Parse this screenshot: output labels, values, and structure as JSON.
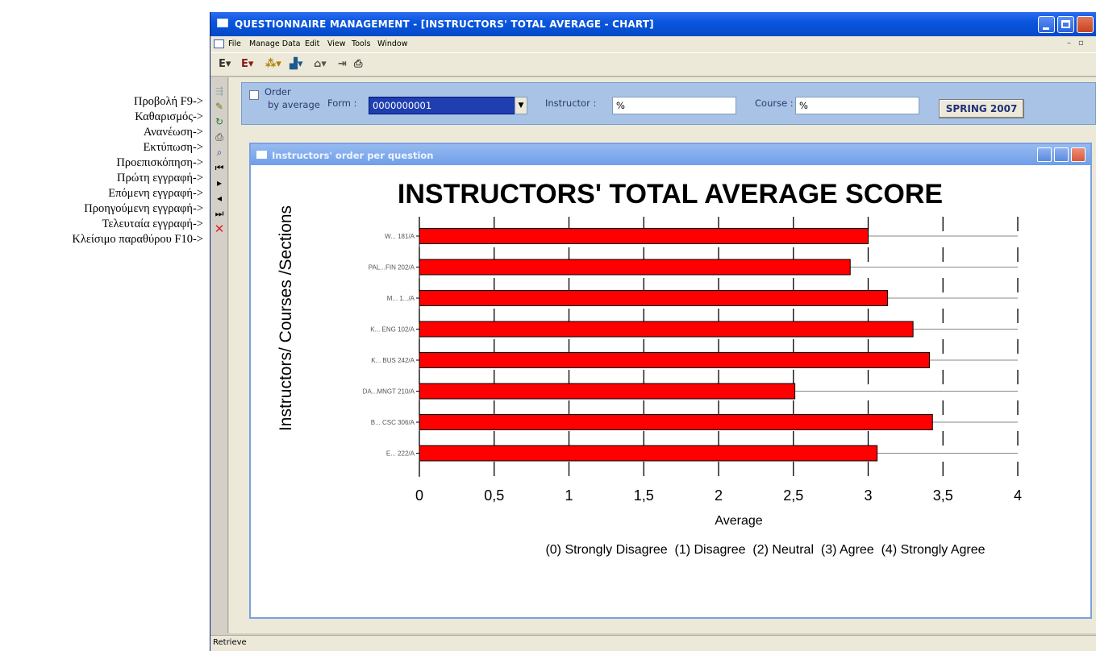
{
  "annotations": [
    "Προβολή F9->",
    "Καθαρισμός->",
    "Ανανέωση->",
    "Εκτύπωση->",
    "Προεπισκόπηση->",
    "Πρώτη εγγραφή->",
    "Επόμενη εγγραφή->",
    "Προηγούμενη εγγραφή->",
    "Τελευταία εγγραφή->",
    "Κλείσιμο παραθύρου F10->"
  ],
  "window": {
    "title": "QUESTIONNAIRE MANAGEMENT - [INSTRUCTORS' TOTAL AVERAGE - CHART]"
  },
  "menu": [
    "File",
    "Manage Data",
    "Edit",
    "View",
    "Tools",
    "Window"
  ],
  "filter": {
    "order_label_line1": "Order",
    "order_label_line2": "by average",
    "form_label": "Form :",
    "form_value": "0000000001",
    "instructor_label": "Instructor :",
    "instructor_value": "%",
    "course_label": "Course :",
    "course_value": "%",
    "semester_button": "SPRING 2007"
  },
  "chart_window": {
    "title": "Instructors' order per question"
  },
  "status": {
    "text": "Retrieve"
  },
  "colors": {
    "bar": "#ff0000",
    "titlebar": "#0a56de",
    "filterbar": "#a9c3e6"
  },
  "chart_data": {
    "type": "bar",
    "orientation": "horizontal",
    "title": "INSTRUCTORS' TOTAL AVERAGE SCORE",
    "xlabel": "Average",
    "ylabel": "Instructors/ Courses /Sections",
    "xlim": [
      0,
      4
    ],
    "xticks": [
      "0",
      "0,5",
      "1",
      "1,5",
      "2",
      "2,5",
      "3",
      "3,5",
      "4"
    ],
    "grid": true,
    "categories": [
      "W... 181/A",
      "PAL...FIN 202/A",
      "M... 1.../A",
      "K... ENG 102/A",
      "K... BUS 242/A",
      "DA...MNGT 210/A",
      "B... CSC 306/A",
      "E... 222/A"
    ],
    "values": [
      3.0,
      2.88,
      3.13,
      3.3,
      3.41,
      2.51,
      3.43,
      3.06
    ],
    "footnote": "(0) Strongly Disagree  (1) Disagree  (2) Neutral  (3) Agree  (4) Strongly Agree"
  }
}
